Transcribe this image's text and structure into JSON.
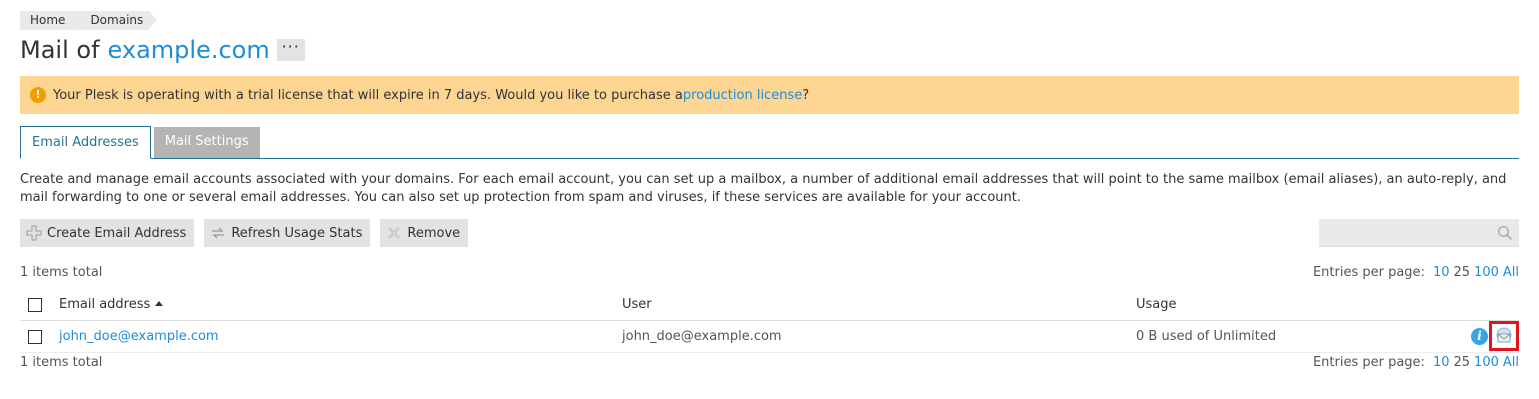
{
  "breadcrumb": {
    "items": [
      "Home",
      "Domains"
    ]
  },
  "header": {
    "title_prefix": "Mail of",
    "domain": "example.com",
    "more_label": "···"
  },
  "trial_banner": {
    "text": "Your Plesk is operating with a trial license that will expire in 7 days. Would you like to purchase a ",
    "link_text": "production license",
    "suffix": "?"
  },
  "tabs": [
    {
      "label": "Email Addresses",
      "active": true
    },
    {
      "label": "Mail Settings",
      "active": false
    }
  ],
  "description": "Create and manage email accounts associated with your domains. For each email account, you can set up a mailbox, a number of additional email addresses that will point to the same mailbox (email aliases), an auto-reply, and mail forwarding to one or several email addresses. You can also set up protection from spam and viruses, if these services are available for your account.",
  "toolbar": {
    "create_label": "Create Email Address",
    "refresh_label": "Refresh Usage Stats",
    "remove_label": "Remove",
    "search_placeholder": ""
  },
  "list": {
    "items_total": "1 items total",
    "entries_label": "Entries per page:",
    "entries_options": [
      "10",
      "25",
      "100",
      "All"
    ],
    "entries_current": "25",
    "columns": {
      "email": "Email address",
      "user": "User",
      "usage": "Usage"
    },
    "rows": [
      {
        "email": "john_doe@example.com",
        "user": "john_doe@example.com",
        "usage": "0 B used of Unlimited"
      }
    ]
  },
  "colors": {
    "accent": "#1f8dd6",
    "banner": "#fdd592",
    "tab_border": "#29728e",
    "highlight": "#e2141c"
  },
  "icons": [
    "warning-icon",
    "plus-icon",
    "refresh-icon",
    "remove-icon",
    "search-icon",
    "sort-asc-icon",
    "info-icon",
    "webmail-icon"
  ]
}
